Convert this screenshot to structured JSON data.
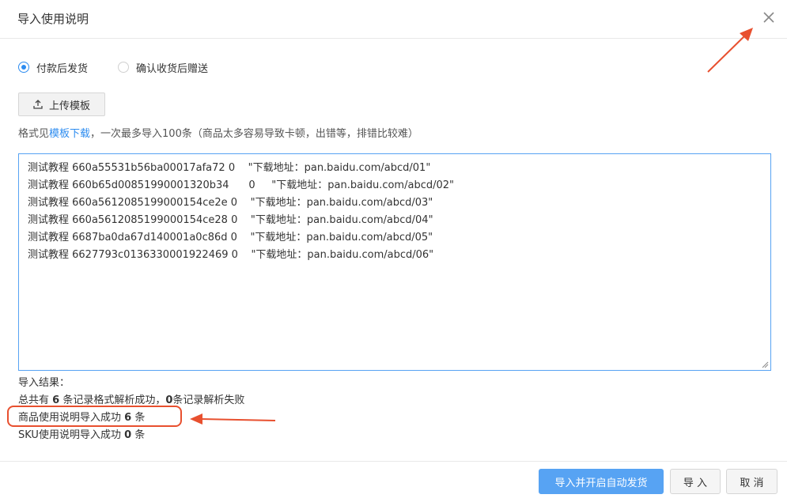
{
  "dialog": {
    "title": "导入使用说明"
  },
  "radios": [
    {
      "label": "付款后发货",
      "checked": true
    },
    {
      "label": "确认收货后赠送",
      "checked": false
    }
  ],
  "upload": {
    "label": "上传模板"
  },
  "hint": {
    "prefix": "格式见",
    "link": "模板下载",
    "suffix": "，一次最多导入100条（商品太多容易导致卡顿，出错等，排错比较难）"
  },
  "textarea": {
    "lines": [
      "测试教程 660a55531b56ba00017afa72 0    \"下载地址：pan.baidu.com/abcd/01\"",
      "测试教程 660b65d00851990001320b34      0     \"下载地址：pan.baidu.com/abcd/02\"",
      "测试教程 660a5612085199000154ce2e 0    \"下载地址：pan.baidu.com/abcd/03\"",
      "测试教程 660a5612085199000154ce28 0    \"下载地址：pan.baidu.com/abcd/04\"",
      "测试教程 6687ba0da67d140001a0c86d 0    \"下载地址：pan.baidu.com/abcd/05\"",
      "测试教程 6627793c0136330001922469 0    \"下载地址：pan.baidu.com/abcd/06\""
    ]
  },
  "result": {
    "heading": "导入结果：",
    "summary_prefix": "总共有 ",
    "summary_count": "6",
    "summary_mid": " 条记录格式解析成功，",
    "summary_fail": "0",
    "summary_suffix": "条记录解析失败",
    "goods_prefix": "商品使用说明导入成功 ",
    "goods_count": "6",
    "goods_suffix": " 条",
    "sku_prefix": "SKU使用说明导入成功 ",
    "sku_count": "0",
    "sku_suffix": " 条"
  },
  "buttons": {
    "import_auto": "导入并开启自动发货",
    "import": "导 入",
    "cancel": "取 消"
  },
  "colors": {
    "accent": "#2d8cf0",
    "primary_button": "#57a3f3",
    "annotation": "#e8502f"
  },
  "icons": {
    "close": "close-icon",
    "upload": "upload-icon"
  }
}
